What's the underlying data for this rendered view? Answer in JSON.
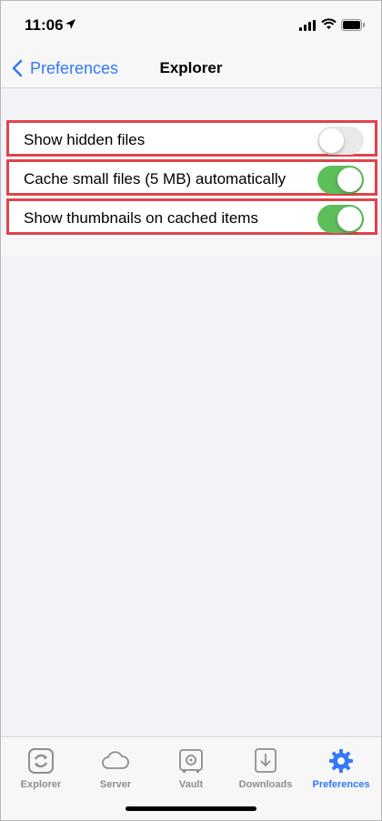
{
  "status_bar": {
    "time": "11:06"
  },
  "nav": {
    "back_label": "Preferences",
    "title": "Explorer"
  },
  "settings": [
    {
      "label": "Show hidden files",
      "enabled": false
    },
    {
      "label": "Cache small files (5 MB) automatically",
      "enabled": true
    },
    {
      "label": "Show thumbnails on cached items",
      "enabled": true
    }
  ],
  "tabs": [
    {
      "label": "Explorer",
      "icon": "sync-icon",
      "active": false
    },
    {
      "label": "Server",
      "icon": "cloud-icon",
      "active": false
    },
    {
      "label": "Vault",
      "icon": "vault-icon",
      "active": false
    },
    {
      "label": "Downloads",
      "icon": "download-icon",
      "active": false
    },
    {
      "label": "Preferences",
      "icon": "gear-icon",
      "active": true
    }
  ],
  "colors": {
    "accent": "#3478f6",
    "toggle_on": "#5cbf5a",
    "highlight_border": "#e0434a"
  }
}
